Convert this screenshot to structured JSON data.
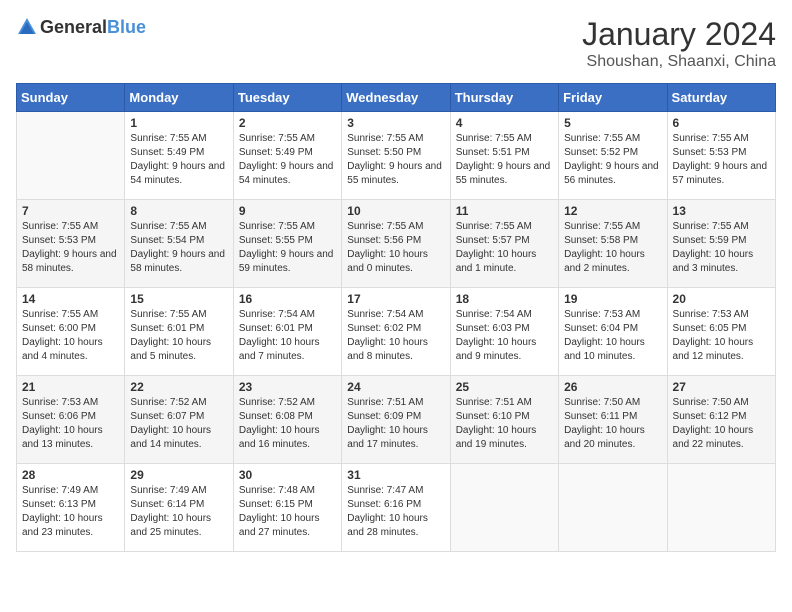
{
  "logo": {
    "text_general": "General",
    "text_blue": "Blue"
  },
  "header": {
    "month_year": "January 2024",
    "location": "Shoushan, Shaanxi, China"
  },
  "weekdays": [
    "Sunday",
    "Monday",
    "Tuesday",
    "Wednesday",
    "Thursday",
    "Friday",
    "Saturday"
  ],
  "weeks": [
    [
      {
        "day": "",
        "sunrise": "",
        "sunset": "",
        "daylight": ""
      },
      {
        "day": "1",
        "sunrise": "Sunrise: 7:55 AM",
        "sunset": "Sunset: 5:49 PM",
        "daylight": "Daylight: 9 hours and 54 minutes."
      },
      {
        "day": "2",
        "sunrise": "Sunrise: 7:55 AM",
        "sunset": "Sunset: 5:49 PM",
        "daylight": "Daylight: 9 hours and 54 minutes."
      },
      {
        "day": "3",
        "sunrise": "Sunrise: 7:55 AM",
        "sunset": "Sunset: 5:50 PM",
        "daylight": "Daylight: 9 hours and 55 minutes."
      },
      {
        "day": "4",
        "sunrise": "Sunrise: 7:55 AM",
        "sunset": "Sunset: 5:51 PM",
        "daylight": "Daylight: 9 hours and 55 minutes."
      },
      {
        "day": "5",
        "sunrise": "Sunrise: 7:55 AM",
        "sunset": "Sunset: 5:52 PM",
        "daylight": "Daylight: 9 hours and 56 minutes."
      },
      {
        "day": "6",
        "sunrise": "Sunrise: 7:55 AM",
        "sunset": "Sunset: 5:53 PM",
        "daylight": "Daylight: 9 hours and 57 minutes."
      }
    ],
    [
      {
        "day": "7",
        "sunrise": "Sunrise: 7:55 AM",
        "sunset": "Sunset: 5:53 PM",
        "daylight": "Daylight: 9 hours and 58 minutes."
      },
      {
        "day": "8",
        "sunrise": "Sunrise: 7:55 AM",
        "sunset": "Sunset: 5:54 PM",
        "daylight": "Daylight: 9 hours and 58 minutes."
      },
      {
        "day": "9",
        "sunrise": "Sunrise: 7:55 AM",
        "sunset": "Sunset: 5:55 PM",
        "daylight": "Daylight: 9 hours and 59 minutes."
      },
      {
        "day": "10",
        "sunrise": "Sunrise: 7:55 AM",
        "sunset": "Sunset: 5:56 PM",
        "daylight": "Daylight: 10 hours and 0 minutes."
      },
      {
        "day": "11",
        "sunrise": "Sunrise: 7:55 AM",
        "sunset": "Sunset: 5:57 PM",
        "daylight": "Daylight: 10 hours and 1 minute."
      },
      {
        "day": "12",
        "sunrise": "Sunrise: 7:55 AM",
        "sunset": "Sunset: 5:58 PM",
        "daylight": "Daylight: 10 hours and 2 minutes."
      },
      {
        "day": "13",
        "sunrise": "Sunrise: 7:55 AM",
        "sunset": "Sunset: 5:59 PM",
        "daylight": "Daylight: 10 hours and 3 minutes."
      }
    ],
    [
      {
        "day": "14",
        "sunrise": "Sunrise: 7:55 AM",
        "sunset": "Sunset: 6:00 PM",
        "daylight": "Daylight: 10 hours and 4 minutes."
      },
      {
        "day": "15",
        "sunrise": "Sunrise: 7:55 AM",
        "sunset": "Sunset: 6:01 PM",
        "daylight": "Daylight: 10 hours and 5 minutes."
      },
      {
        "day": "16",
        "sunrise": "Sunrise: 7:54 AM",
        "sunset": "Sunset: 6:01 PM",
        "daylight": "Daylight: 10 hours and 7 minutes."
      },
      {
        "day": "17",
        "sunrise": "Sunrise: 7:54 AM",
        "sunset": "Sunset: 6:02 PM",
        "daylight": "Daylight: 10 hours and 8 minutes."
      },
      {
        "day": "18",
        "sunrise": "Sunrise: 7:54 AM",
        "sunset": "Sunset: 6:03 PM",
        "daylight": "Daylight: 10 hours and 9 minutes."
      },
      {
        "day": "19",
        "sunrise": "Sunrise: 7:53 AM",
        "sunset": "Sunset: 6:04 PM",
        "daylight": "Daylight: 10 hours and 10 minutes."
      },
      {
        "day": "20",
        "sunrise": "Sunrise: 7:53 AM",
        "sunset": "Sunset: 6:05 PM",
        "daylight": "Daylight: 10 hours and 12 minutes."
      }
    ],
    [
      {
        "day": "21",
        "sunrise": "Sunrise: 7:53 AM",
        "sunset": "Sunset: 6:06 PM",
        "daylight": "Daylight: 10 hours and 13 minutes."
      },
      {
        "day": "22",
        "sunrise": "Sunrise: 7:52 AM",
        "sunset": "Sunset: 6:07 PM",
        "daylight": "Daylight: 10 hours and 14 minutes."
      },
      {
        "day": "23",
        "sunrise": "Sunrise: 7:52 AM",
        "sunset": "Sunset: 6:08 PM",
        "daylight": "Daylight: 10 hours and 16 minutes."
      },
      {
        "day": "24",
        "sunrise": "Sunrise: 7:51 AM",
        "sunset": "Sunset: 6:09 PM",
        "daylight": "Daylight: 10 hours and 17 minutes."
      },
      {
        "day": "25",
        "sunrise": "Sunrise: 7:51 AM",
        "sunset": "Sunset: 6:10 PM",
        "daylight": "Daylight: 10 hours and 19 minutes."
      },
      {
        "day": "26",
        "sunrise": "Sunrise: 7:50 AM",
        "sunset": "Sunset: 6:11 PM",
        "daylight": "Daylight: 10 hours and 20 minutes."
      },
      {
        "day": "27",
        "sunrise": "Sunrise: 7:50 AM",
        "sunset": "Sunset: 6:12 PM",
        "daylight": "Daylight: 10 hours and 22 minutes."
      }
    ],
    [
      {
        "day": "28",
        "sunrise": "Sunrise: 7:49 AM",
        "sunset": "Sunset: 6:13 PM",
        "daylight": "Daylight: 10 hours and 23 minutes."
      },
      {
        "day": "29",
        "sunrise": "Sunrise: 7:49 AM",
        "sunset": "Sunset: 6:14 PM",
        "daylight": "Daylight: 10 hours and 25 minutes."
      },
      {
        "day": "30",
        "sunrise": "Sunrise: 7:48 AM",
        "sunset": "Sunset: 6:15 PM",
        "daylight": "Daylight: 10 hours and 27 minutes."
      },
      {
        "day": "31",
        "sunrise": "Sunrise: 7:47 AM",
        "sunset": "Sunset: 6:16 PM",
        "daylight": "Daylight: 10 hours and 28 minutes."
      },
      {
        "day": "",
        "sunrise": "",
        "sunset": "",
        "daylight": ""
      },
      {
        "day": "",
        "sunrise": "",
        "sunset": "",
        "daylight": ""
      },
      {
        "day": "",
        "sunrise": "",
        "sunset": "",
        "daylight": ""
      }
    ]
  ]
}
